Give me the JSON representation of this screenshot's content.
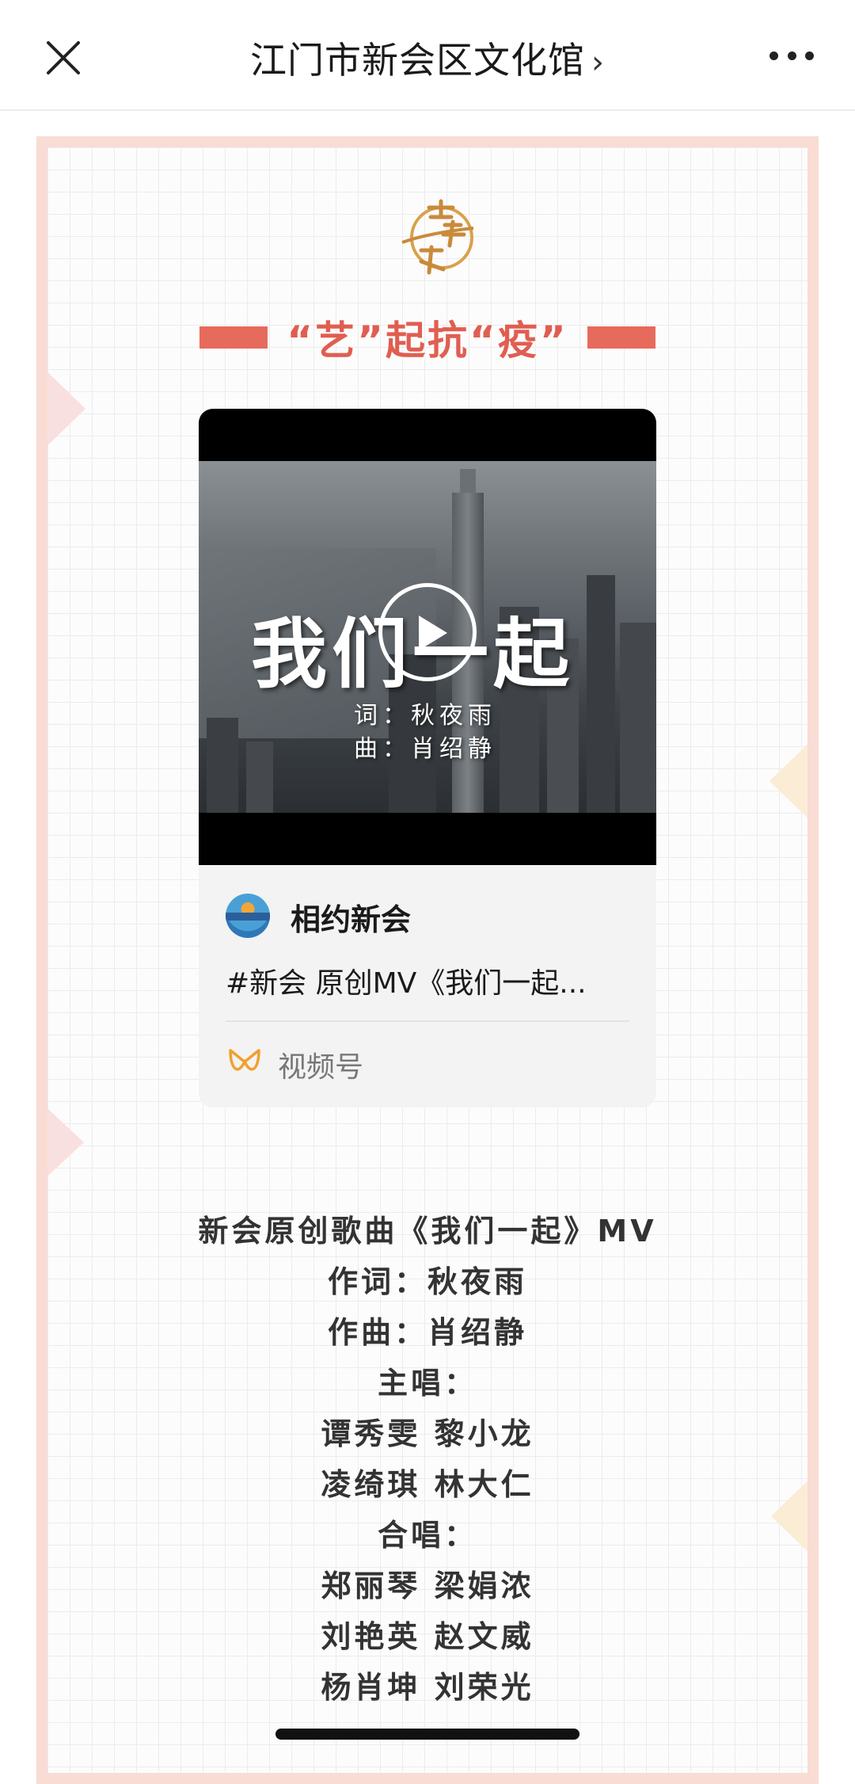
{
  "topbar": {
    "close_icon": "close-icon",
    "title": "江门市新会区文化馆",
    "chevron": "›",
    "more_icon": "more-icon"
  },
  "article": {
    "logo_icon": "music-home-logo",
    "heading": "“艺”起抗“疫”",
    "video_card": {
      "video_title": "我们一起",
      "lyricist_line": "词：秋夜雨",
      "composer_line": "曲：肖绍静",
      "play_icon": "play-icon",
      "account_name": "相约新会",
      "description": "#新会 原创MV《我们一起...",
      "channel_label": "视频号",
      "channel_icon": "channels-icon"
    },
    "credits": [
      "新会原创歌曲《我们一起》MV",
      "作词：秋夜雨",
      "作曲：肖绍静",
      "主唱：",
      "谭秀雯 黎小龙",
      "凌绮琪 林大仁",
      "合唱：",
      "郑丽琴 梁娟浓",
      "刘艳英 赵文威",
      "杨肖坤 刘荣光"
    ]
  },
  "colors": {
    "accent": "#e05e51",
    "frame_border": "#f9dcd3",
    "channel_icon": "#f0a030"
  }
}
